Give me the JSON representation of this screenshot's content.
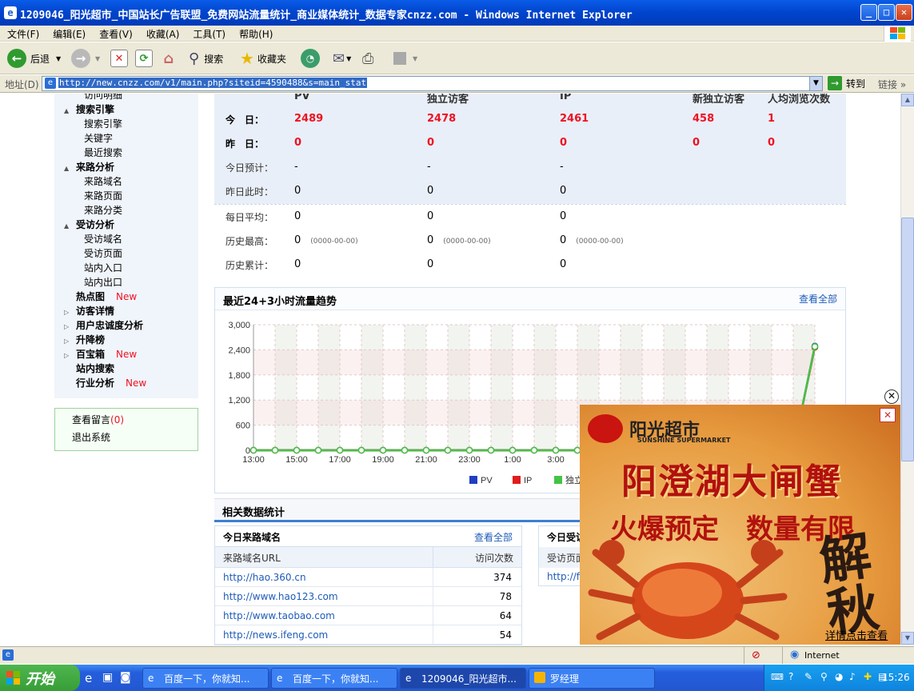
{
  "window": {
    "title": "1209046_阳光超市_中国站长广告联盟_免费网站流量统计_商业媒体统计_数据专家cnzz.com - Windows Internet Explorer"
  },
  "menu": [
    "文件(F)",
    "编辑(E)",
    "查看(V)",
    "收藏(A)",
    "工具(T)",
    "帮助(H)"
  ],
  "toolbar": {
    "back": "后退",
    "search": "搜索",
    "favorites": "收藏夹"
  },
  "address": {
    "label": "地址(D)",
    "url": "http://new.cnzz.com/v1/main.php?siteid=4590488&s=main_stat",
    "go": "转到",
    "links": "链接"
  },
  "sidebar": {
    "items": [
      {
        "label": "访问明细",
        "type": "sub"
      },
      {
        "label": "搜索引擎",
        "type": "cat",
        "arrow": "▲"
      },
      {
        "label": "搜索引擎",
        "type": "sub"
      },
      {
        "label": "关键字",
        "type": "sub"
      },
      {
        "label": "最近搜索",
        "type": "sub"
      },
      {
        "label": "来路分析",
        "type": "cat",
        "arrow": "▲"
      },
      {
        "label": "来路域名",
        "type": "sub"
      },
      {
        "label": "来路页面",
        "type": "sub"
      },
      {
        "label": "来路分类",
        "type": "sub"
      },
      {
        "label": "受访分析",
        "type": "cat",
        "arrow": "▲"
      },
      {
        "label": "受访域名",
        "type": "sub"
      },
      {
        "label": "受访页面",
        "type": "sub"
      },
      {
        "label": "站内入口",
        "type": "sub"
      },
      {
        "label": "站内出口",
        "type": "sub"
      },
      {
        "label": "热点图",
        "type": "cat",
        "arrow": "",
        "new": "New"
      },
      {
        "label": "访客详情",
        "type": "cat",
        "arrow": "▷"
      },
      {
        "label": "用户忠诚度分析",
        "type": "cat",
        "arrow": "▷"
      },
      {
        "label": "升降榜",
        "type": "cat",
        "arrow": "▷"
      },
      {
        "label": "百宝箱",
        "type": "cat",
        "arrow": "▷",
        "new": "New"
      },
      {
        "label": "站内搜索",
        "type": "cat",
        "arrow": ""
      },
      {
        "label": "行业分析",
        "type": "cat",
        "arrow": "",
        "new": "New"
      }
    ],
    "messages": "查看留言",
    "messages_count": "(0)",
    "logout": "退出系统"
  },
  "stats": {
    "headers": [
      "PV",
      "独立访客",
      "IP",
      "新独立访客",
      "人均浏览次数"
    ],
    "rows": [
      {
        "label": "今　日：",
        "values": [
          "2489",
          "2478",
          "2461",
          "458",
          "1"
        ],
        "style": "red"
      },
      {
        "label": "昨　日：",
        "values": [
          "0",
          "0",
          "0",
          "0",
          "0"
        ],
        "style": "red"
      },
      {
        "label": "今日预计：",
        "values": [
          "-",
          "-",
          "-"
        ],
        "style": "plain"
      },
      {
        "label": "昨日此时：",
        "values": [
          "0",
          "0",
          "0"
        ],
        "style": "plain"
      },
      {
        "label": "每日平均：",
        "values": [
          "0",
          "0",
          "0"
        ],
        "style": "plain"
      },
      {
        "label": "历史最高：",
        "values": [
          "0",
          "0",
          "0"
        ],
        "dates": [
          "(0000-00-00)",
          "(0000-00-00)",
          "(0000-00-00)"
        ],
        "style": "plain"
      },
      {
        "label": "历史累计：",
        "values": [
          "0",
          "0",
          "0"
        ],
        "style": "plain"
      }
    ]
  },
  "chart_panel": {
    "title": "最近24+3小时流量趋势",
    "view_all": "查看全部"
  },
  "chart_data": {
    "type": "line",
    "title": "最近24+3小时流量趋势",
    "x": [
      "13:00",
      "14:00",
      "15:00",
      "16:00",
      "17:00",
      "18:00",
      "19:00",
      "20:00",
      "21:00",
      "22:00",
      "23:00",
      "0:00",
      "1:00",
      "2:00",
      "3:00",
      "4:00",
      "5:00",
      "6:00",
      "7:00",
      "8:00",
      "9:00",
      "10:00",
      "11:00",
      "12:00",
      "13:00",
      "14:00",
      "15:00"
    ],
    "xticks": [
      "13:00",
      "15:00",
      "17:00",
      "19:00",
      "21:00",
      "23:00",
      "1:00",
      "3:00"
    ],
    "ylim": [
      0,
      3000
    ],
    "yticks": [
      "0",
      "600",
      "1,200",
      "1,800",
      "2,400",
      "3,000"
    ],
    "series": [
      {
        "name": "PV",
        "color": "#1f3fbf",
        "values": [
          0,
          0,
          0,
          0,
          0,
          0,
          0,
          0,
          0,
          0,
          0,
          0,
          0,
          0,
          0,
          0,
          0,
          0,
          0,
          0,
          0,
          0,
          0,
          0,
          0,
          0,
          2489
        ]
      },
      {
        "name": "IP",
        "color": "#e21b1b",
        "values": [
          0,
          0,
          0,
          0,
          0,
          0,
          0,
          0,
          0,
          0,
          0,
          0,
          0,
          0,
          0,
          0,
          0,
          0,
          0,
          0,
          0,
          0,
          0,
          0,
          0,
          0,
          2461
        ]
      },
      {
        "name": "独立访客",
        "color": "#44c344",
        "values": [
          0,
          0,
          0,
          0,
          0,
          0,
          0,
          0,
          0,
          0,
          0,
          0,
          0,
          0,
          0,
          0,
          0,
          0,
          0,
          0,
          0,
          0,
          0,
          0,
          0,
          0,
          2478
        ]
      }
    ],
    "legend": [
      "PV",
      "IP",
      "独立"
    ]
  },
  "related": {
    "title": "相关数据统计",
    "domains": {
      "title": "今日来路域名",
      "view_all": "查看全部",
      "col1": "来路域名URL",
      "col2": "访问次数",
      "rows": [
        {
          "url": "http://hao.360.cn",
          "count": "374"
        },
        {
          "url": "http://www.hao123.com",
          "count": "78"
        },
        {
          "url": "http://www.taobao.com",
          "count": "64"
        },
        {
          "url": "http://news.ifeng.com",
          "count": "54"
        }
      ]
    },
    "pages": {
      "title": "今日受访",
      "col1": "受访页面",
      "first": "http://fo"
    }
  },
  "ad": {
    "brand": "阳光超市",
    "brand_en": "SUNSHINE SUPERMARKET",
    "headline": "阳澄湖大闸蟹",
    "subline": "火爆预定　数量有限",
    "calligraphy": "解\n秋",
    "more": "详情点击查看"
  },
  "statusbar": {
    "zone": "Internet"
  },
  "taskbar": {
    "start": "开始",
    "tasks": [
      "百度一下，你就知...",
      "百度一下，你就知...",
      "1209046_阳光超市...",
      "罗经理"
    ],
    "clock": "15:26"
  }
}
